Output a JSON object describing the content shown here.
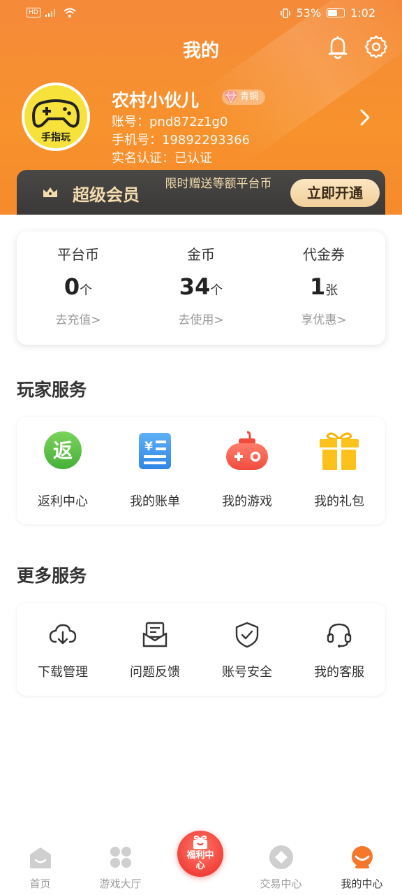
{
  "status_bar": {
    "network": "HD 4G",
    "battery_percent": "53%",
    "battery_level": 0.53,
    "time": "1:02"
  },
  "header": {
    "title": "我的"
  },
  "profile": {
    "avatar_text": "手指玩",
    "username": "农村小伙儿",
    "level_badge": "青铜",
    "account": "账号：pnd872z1g0",
    "phone": "手机号：19892293366",
    "realname": "实名认证：已认证"
  },
  "vip": {
    "title": "超级会员",
    "desc": "限时赠送等额平台币",
    "button": "立即开通"
  },
  "wallet": [
    {
      "label": "平台币",
      "value": "0",
      "unit": "个",
      "link": "去充值>"
    },
    {
      "label": "金币",
      "value": "34",
      "unit": "个",
      "link": "去使用>"
    },
    {
      "label": "代金券",
      "value": "1",
      "unit": "张",
      "link": "享优惠>"
    }
  ],
  "player_services": {
    "title": "玩家服务",
    "items": [
      {
        "label": "返利中心",
        "icon": "rebate-icon",
        "icon_text": "返"
      },
      {
        "label": "我的账单",
        "icon": "bill-icon",
        "icon_text": "¥"
      },
      {
        "label": "我的游戏",
        "icon": "gamepad-icon"
      },
      {
        "label": "我的礼包",
        "icon": "gift-icon"
      }
    ]
  },
  "more_services": {
    "title": "更多服务",
    "items": [
      {
        "label": "下载管理",
        "icon": "cloud-download-icon"
      },
      {
        "label": "问题反馈",
        "icon": "feedback-icon"
      },
      {
        "label": "账号安全",
        "icon": "shield-icon"
      },
      {
        "label": "我的客服",
        "icon": "headset-icon"
      }
    ]
  },
  "bottom_nav": {
    "items": [
      {
        "label": "首页",
        "icon": "home-icon",
        "active": false
      },
      {
        "label": "游戏大厅",
        "icon": "grid-icon",
        "active": false
      },
      {
        "label": "交易中心",
        "icon": "diamond-icon",
        "active": false
      },
      {
        "label": "我的中心",
        "icon": "profile-icon",
        "active": true
      }
    ],
    "center_text": "福利中心",
    "center_icon": "welfare-icon"
  },
  "colors": {
    "brand_orange": "#f7922c",
    "vip_dark": "#3a3938",
    "vip_gold": "#f1cf99",
    "active_orange": "#f5772a"
  }
}
